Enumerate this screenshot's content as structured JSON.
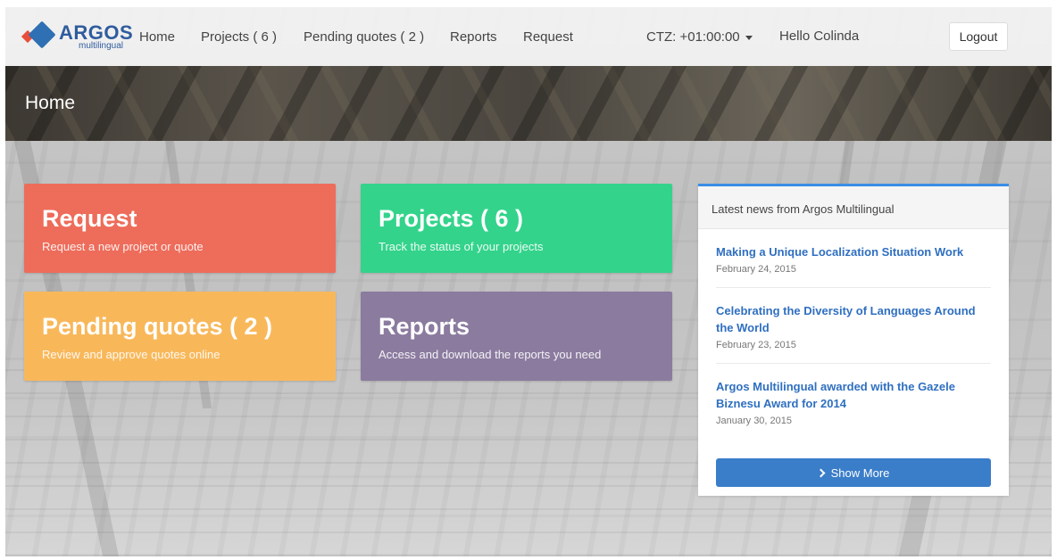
{
  "brand": {
    "name": "ARGOS",
    "tagline": "multilingual"
  },
  "nav": {
    "home": "Home",
    "projects": "Projects ( 6 )",
    "pending_quotes": "Pending quotes ( 2 )",
    "reports": "Reports",
    "request": "Request",
    "timezone": "CTZ: +01:00:00",
    "greeting": "Hello Colinda",
    "logout": "Logout"
  },
  "page": {
    "title": "Home"
  },
  "tiles": [
    {
      "title": "Request",
      "subtitle": "Request a new project or quote",
      "color": "#ee6c5a"
    },
    {
      "title": "Projects ( 6 )",
      "subtitle": "Track the status of your projects",
      "color": "#33d38b"
    },
    {
      "title": "Pending quotes ( 2 )",
      "subtitle": "Review and approve quotes online",
      "color": "#f8b85a"
    },
    {
      "title": "Reports",
      "subtitle": "Access and download the reports you need",
      "color": "#8b7b9f"
    }
  ],
  "news": {
    "header": "Latest news from Argos Multilingual",
    "items": [
      {
        "title": "Making a Unique Localization Situation Work",
        "date": "February 24, 2015"
      },
      {
        "title": "Celebrating the Diversity of Languages Around the World",
        "date": "February 23, 2015"
      },
      {
        "title": "Argos Multilingual awarded with the Gazele Biznesu Award for 2014",
        "date": "January 30, 2015"
      }
    ],
    "show_more": "Show More"
  },
  "colors": {
    "accent": "#3a7dc9",
    "link": "#2f6fc0",
    "news_top_border": "#3a8ee6"
  }
}
